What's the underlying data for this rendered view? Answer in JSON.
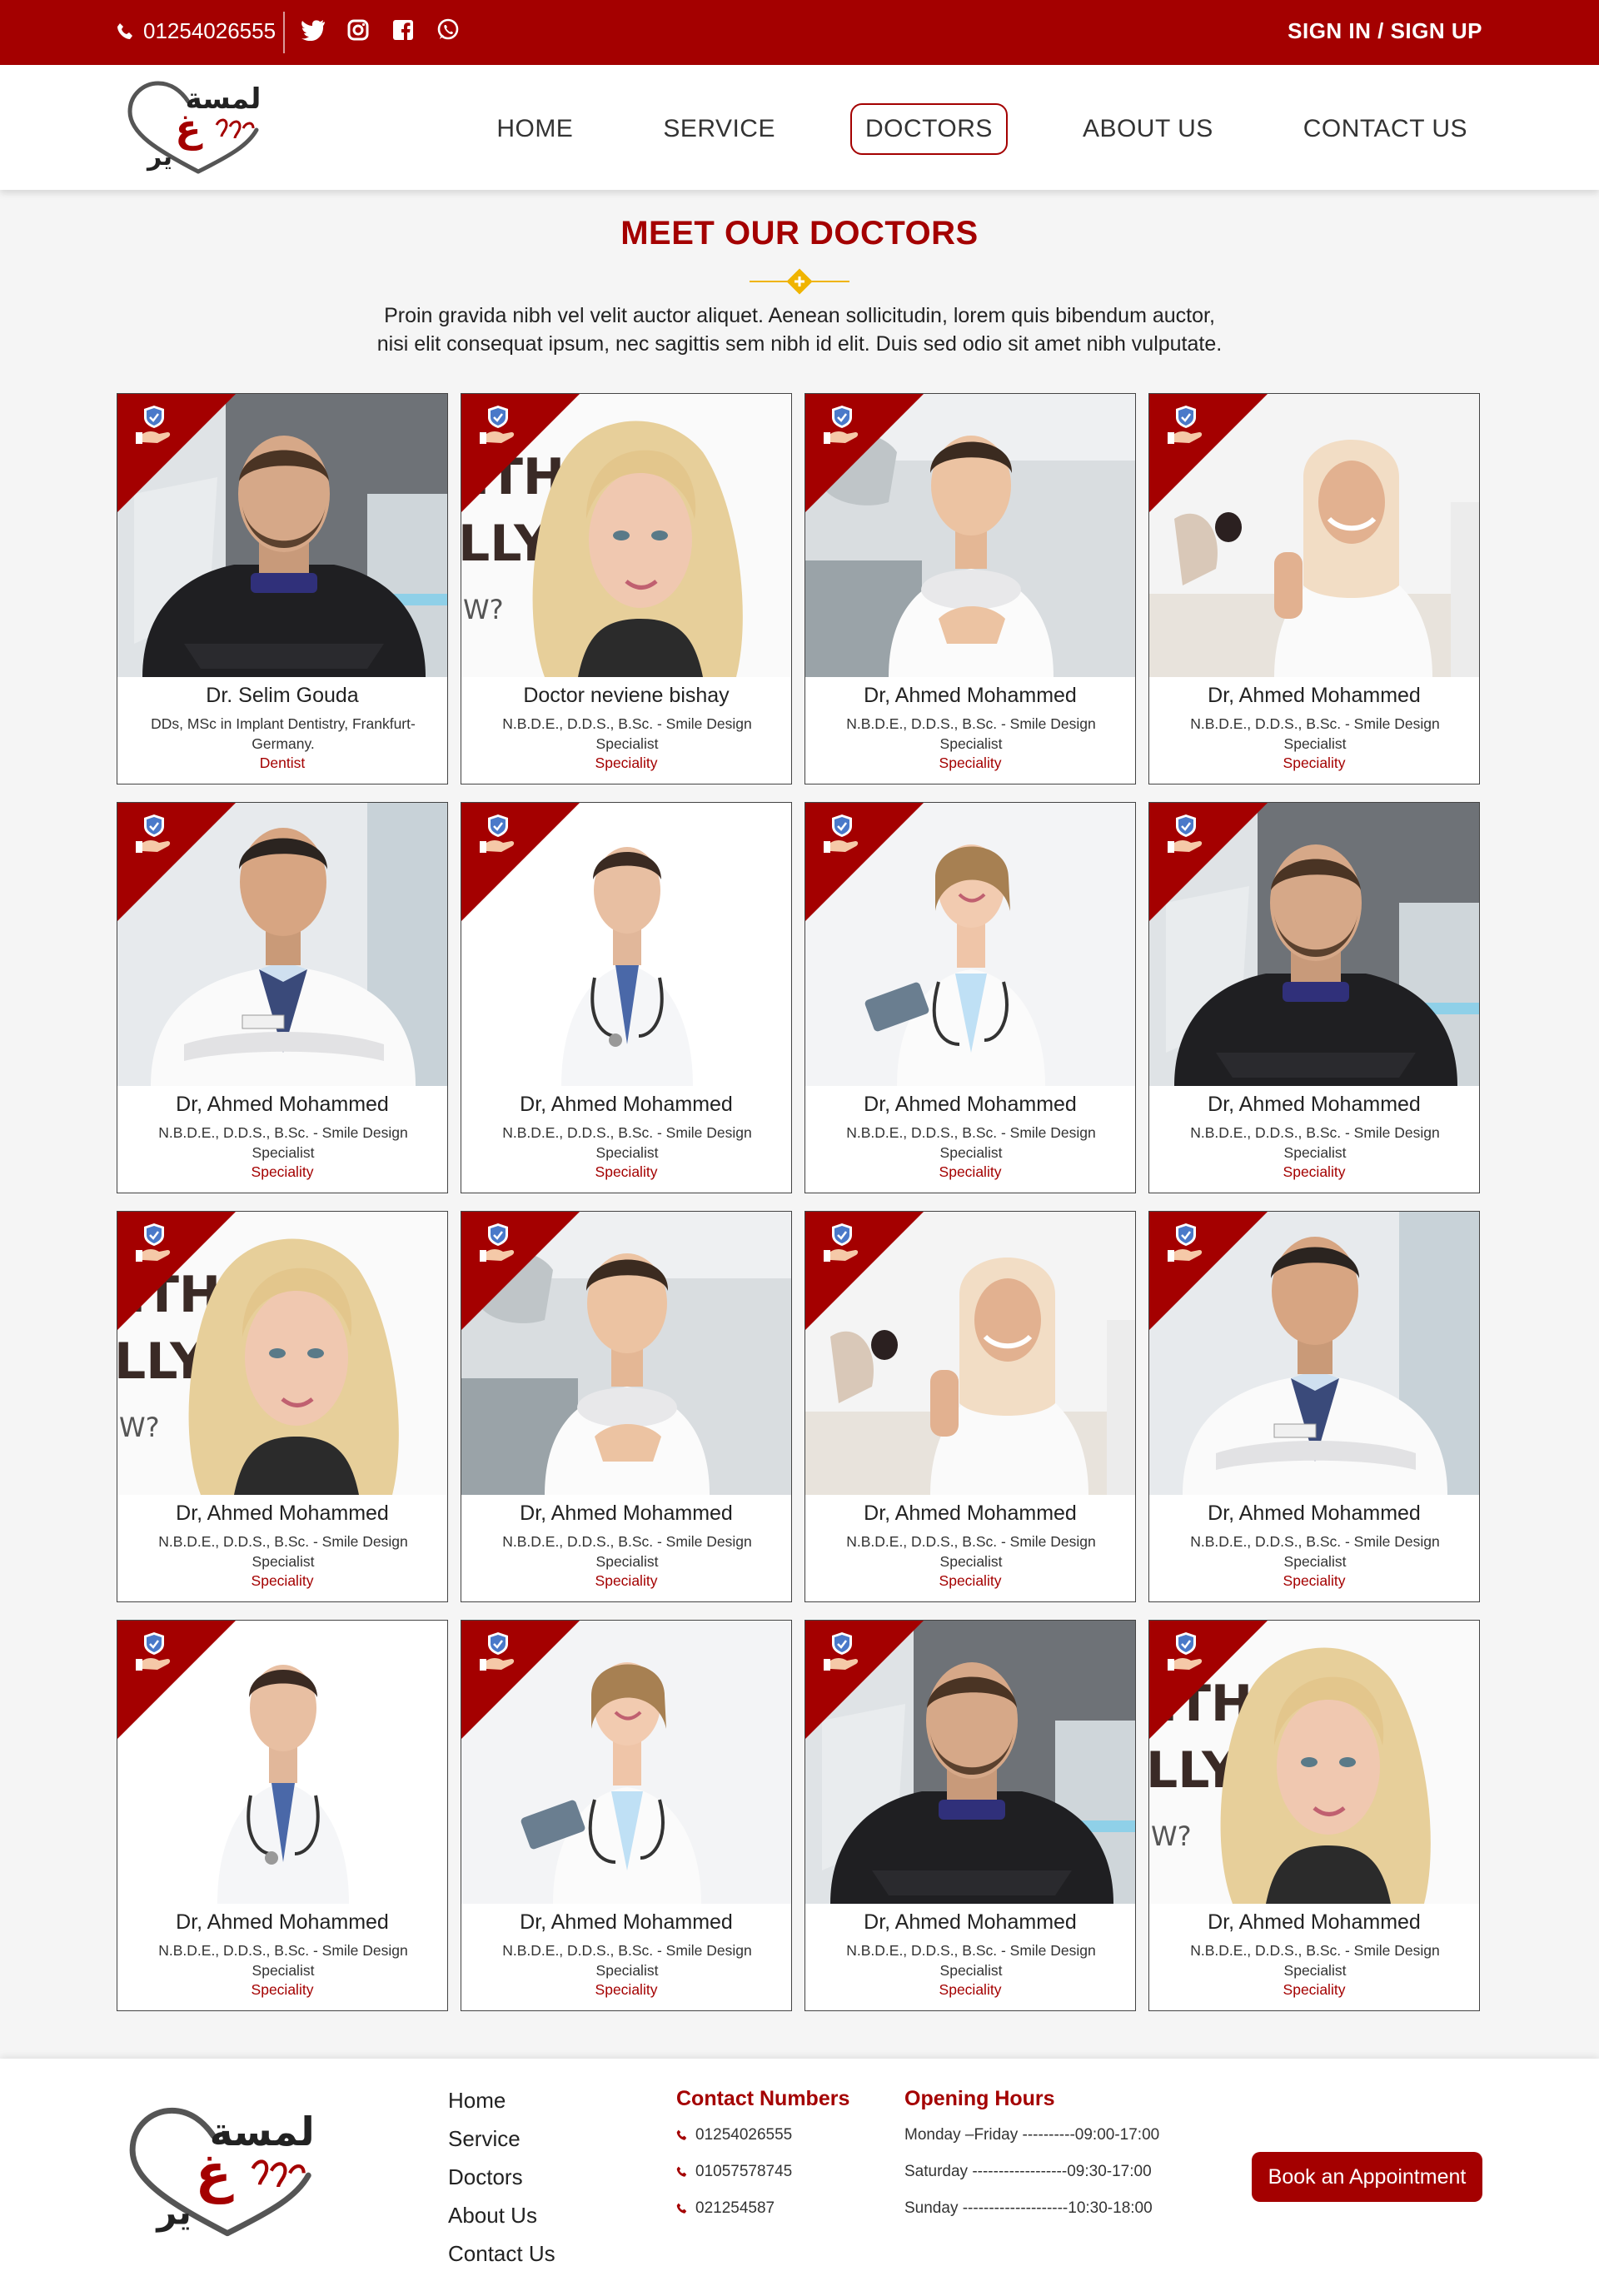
{
  "topbar": {
    "phone": "01254026555",
    "socials": [
      "twitter-icon",
      "instagram-icon",
      "facebook-icon",
      "whatsapp-icon"
    ],
    "auth_label": "SIGN IN / SIGN UP",
    "bg_color": "#a40000"
  },
  "nav": {
    "items": [
      {
        "label": "HOME",
        "active": false
      },
      {
        "label": "SERVICE",
        "active": false
      },
      {
        "label": "DOCTORS",
        "active": true
      },
      {
        "label": "ABOUT US",
        "active": false
      },
      {
        "label": "CONTACT US",
        "active": false
      }
    ]
  },
  "section": {
    "title": "MEET OUR DOCTORS",
    "intro_line1": "Proin gravida nibh vel velit auctor aliquet. Aenean sollicitudin, lorem quis bibendum auctor,",
    "intro_line2": "nisi elit consequat ipsum, nec sagittis sem nibh id elit. Duis sed odio sit amet nibh vulputate."
  },
  "doctors": [
    {
      "name": "Dr. Selim Gouda",
      "cred": "DDs, MSc in Implant Dentistry, Frankfurt- Germany.",
      "spec": "Dentist",
      "photo": "beard-dark"
    },
    {
      "name": "Doctor neviene bishay",
      "cred": "N.B.D.E., D.D.S., B.Sc. - Smile Design Specialist",
      "spec": "Speciality",
      "photo": "blonde"
    },
    {
      "name": "Dr, Ahmed Mohammed",
      "cred": "N.B.D.E., D.D.S., B.Sc. - Smile Design Specialist",
      "spec": "Speciality",
      "photo": "young-coat"
    },
    {
      "name": "Dr, Ahmed Mohammed",
      "cred": "N.B.D.E., D.D.S., B.Sc. - Smile Design Specialist",
      "spec": "Speciality",
      "photo": "hijab"
    },
    {
      "name": "Dr, Ahmed Mohammed",
      "cred": "N.B.D.E., D.D.S., B.Sc. - Smile Design Specialist",
      "spec": "Speciality",
      "photo": "tie-coat"
    },
    {
      "name": "Dr, Ahmed Mohammed",
      "cred": "N.B.D.E., D.D.S., B.Sc. - Smile Design Specialist",
      "spec": "Speciality",
      "photo": "steth-man"
    },
    {
      "name": "Dr, Ahmed Mohammed",
      "cred": "N.B.D.E., D.D.S., B.Sc. - Smile Design Specialist",
      "spec": "Speciality",
      "photo": "woman-tablet"
    },
    {
      "name": "Dr, Ahmed Mohammed",
      "cred": "N.B.D.E., D.D.S., B.Sc. - Smile Design Specialist",
      "spec": "Speciality",
      "photo": "beard-dark"
    },
    {
      "name": "Dr, Ahmed Mohammed",
      "cred": "N.B.D.E., D.D.S., B.Sc. - Smile Design Specialist",
      "spec": "Speciality",
      "photo": "blonde"
    },
    {
      "name": "Dr, Ahmed Mohammed",
      "cred": "N.B.D.E., D.D.S., B.Sc. - Smile Design Specialist",
      "spec": "Speciality",
      "photo": "young-coat"
    },
    {
      "name": "Dr, Ahmed Mohammed",
      "cred": "N.B.D.E., D.D.S., B.Sc. - Smile Design Specialist",
      "spec": "Speciality",
      "photo": "hijab"
    },
    {
      "name": "Dr, Ahmed Mohammed",
      "cred": "N.B.D.E., D.D.S., B.Sc. - Smile Design Specialist",
      "spec": "Speciality",
      "photo": "tie-coat"
    },
    {
      "name": "Dr, Ahmed Mohammed",
      "cred": "N.B.D.E., D.D.S., B.Sc. - Smile Design Specialist",
      "spec": "Speciality",
      "photo": "steth-man"
    },
    {
      "name": "Dr, Ahmed Mohammed",
      "cred": "N.B.D.E., D.D.S., B.Sc. - Smile Design Specialist",
      "spec": "Speciality",
      "photo": "woman-tablet"
    },
    {
      "name": "Dr, Ahmed Mohammed",
      "cred": "N.B.D.E., D.D.S., B.Sc. - Smile Design Specialist",
      "spec": "Speciality",
      "photo": "beard-dark"
    },
    {
      "name": "Dr, Ahmed Mohammed",
      "cred": "N.B.D.E., D.D.S., B.Sc. - Smile Design Specialist",
      "spec": "Speciality",
      "photo": "blonde"
    }
  ],
  "footer": {
    "links": [
      "Home",
      "Service",
      "Doctors",
      "About Us",
      "Contact Us"
    ],
    "contact_title": "Contact Numbers",
    "contacts": [
      "01254026555",
      "01057578745",
      "021254587"
    ],
    "hours_title": "Opening Hours",
    "hours": [
      "Monday –Friday ----------09:00-17:00",
      "Saturday ------------------09:30-17:00",
      "Sunday --------------------10:30-18:00"
    ],
    "book_label": "Book an Appointment"
  },
  "theme": {
    "accent": "#a40000",
    "gold": "#f0b400"
  }
}
